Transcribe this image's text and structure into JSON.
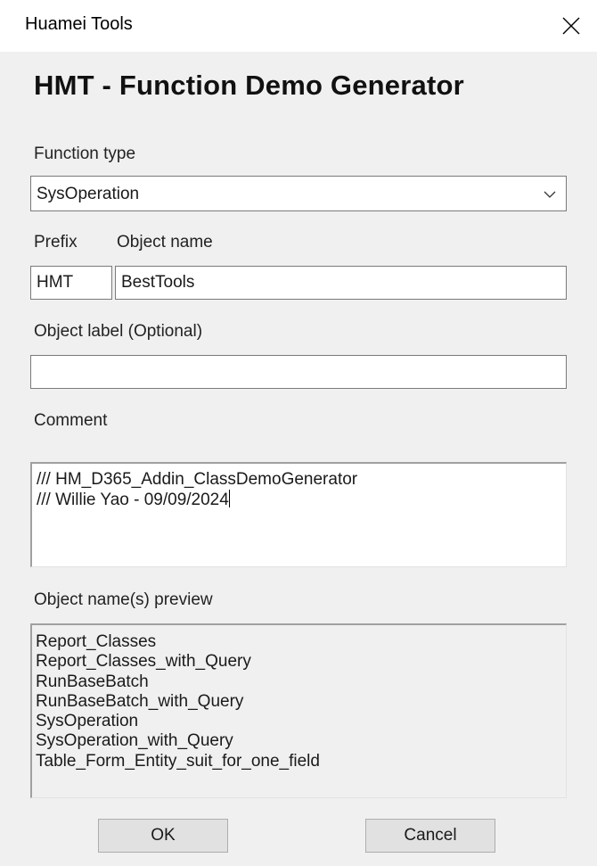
{
  "window": {
    "title": "Huamei Tools"
  },
  "heading": "HMT - Function Demo Generator",
  "function_type": {
    "label": "Function type",
    "selected": "SysOperation"
  },
  "prefix": {
    "label": "Prefix",
    "value": "HMT"
  },
  "object_name": {
    "label": "Object name",
    "value": "BestTools"
  },
  "object_label": {
    "label": "Object label (Optional)",
    "value": ""
  },
  "comment": {
    "label": "Comment",
    "lines": [
      "/// HM_D365_Addin_ClassDemoGenerator",
      "/// Willie Yao - 09/09/2024"
    ]
  },
  "preview": {
    "label": "Object name(s) preview",
    "items": [
      "Report_Classes",
      "Report_Classes_with_Query",
      "RunBaseBatch",
      "RunBaseBatch_with_Query",
      "SysOperation",
      "SysOperation_with_Query",
      "Table_Form_Entity_suit_for_one_field"
    ]
  },
  "buttons": {
    "ok": "OK",
    "cancel": "Cancel"
  },
  "icons": {
    "close": "close-icon",
    "dropdown": "chevron-down-icon"
  }
}
